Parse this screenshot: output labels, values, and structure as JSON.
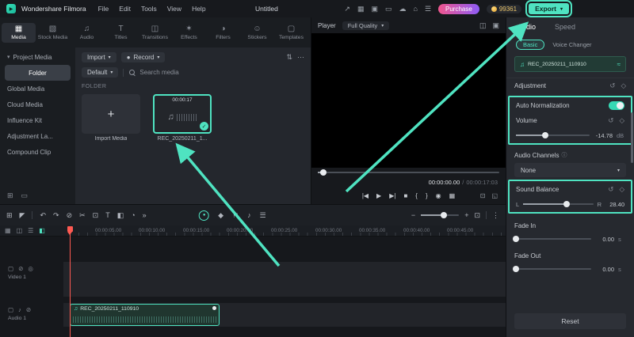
{
  "colors": {
    "accent": "#4fe3c1",
    "playhead": "#ff5a52"
  },
  "menubar": {
    "app_name": "Wondershare Filmora",
    "menus": [
      "File",
      "Edit",
      "Tools",
      "View",
      "Help"
    ],
    "project_title": "Untitled",
    "purchase_label": "Purchase",
    "coin_count": "99361",
    "export_label": "Export"
  },
  "media_panel": {
    "tabs": [
      "Media",
      "Stock Media",
      "Audio",
      "Titles",
      "Transitions",
      "Effects",
      "Filters",
      "Stickers",
      "Templates"
    ],
    "sidebar": [
      "Project Media",
      "Folder",
      "Global Media",
      "Cloud Media",
      "Influence Kit",
      "Adjustment La...",
      "Compound Clip"
    ],
    "toolbar": {
      "import_label": "Import",
      "record_label": "Record",
      "default_label": "Default",
      "search_placeholder": "Search media"
    },
    "folder_label": "FOLDER",
    "import_tile_label": "Import Media",
    "clip_name": "REC_20250211_1...",
    "clip_duration": "00:00:17"
  },
  "player": {
    "title": "Player",
    "quality": "Full Quality",
    "current_time": "00:00:00.00",
    "separator": "/",
    "total_time": "00:00:17:03"
  },
  "props": {
    "tab_audio": "Audio",
    "tab_speed": "Speed",
    "subtab_basic": "Basic",
    "subtab_voice": "Voice Changer",
    "clip_name": "REC_20250211_110910",
    "adjustment": "Adjustment",
    "auto_normalization": "Auto Normalization",
    "volume": "Volume",
    "volume_value": "-14.78",
    "volume_unit": "dB",
    "audio_channels": "Audio Channels",
    "channels_value": "None",
    "sound_balance": "Sound Balance",
    "balance_left": "L",
    "balance_right": "R",
    "balance_value": "28.40",
    "fade_in": "Fade In",
    "fade_in_value": "0.00",
    "fade_out": "Fade Out",
    "fade_out_value": "0.00",
    "unit_s": "s",
    "reset_label": "Reset"
  },
  "timeline": {
    "ruler": [
      "00:00:05.00",
      "00:00:10.00",
      "00:00:15.00",
      "00:00:20.00",
      "00:00:25.00",
      "00:00:30.00",
      "00:00:35.00",
      "00:00:40.00",
      "00:00:45.00"
    ],
    "video_track": "Video 1",
    "audio_track": "Audio 1",
    "clip_name": "REC_20250211_110910"
  },
  "icons": {
    "logo": "▶",
    "caret": "▾",
    "share": "↗",
    "layout": "▦",
    "screen": "▣",
    "device": "▭",
    "cloud": "☁",
    "home": "⌂",
    "menu": "☰",
    "record_dot": "●",
    "filter": "⇅",
    "more_h": "⋯",
    "more_v": "⋮",
    "plus": "+",
    "music": "♫",
    "check": "✓",
    "compare": "◫",
    "panel": "▣",
    "prev": "|◀",
    "play": "▶",
    "next": "▶|",
    "stop": "■",
    "mark_in": "{",
    "mark_out": "}",
    "snapshot": "◉",
    "grid": "▦",
    "crop": "⊡",
    "expand": "◱",
    "snap": "⊞",
    "pointer": "◤",
    "undo": "↶",
    "redo": "↷",
    "trash": "⊘",
    "split": "✂",
    "text": "T",
    "mask": "◧",
    "speed": "◔",
    "chevrons": "»",
    "keyframe": "◆",
    "marker": "⚑",
    "mic": "♪",
    "mixer": "☰",
    "zoom_out": "−",
    "zoom_in": "+",
    "fit": "⊡",
    "reset": "↺",
    "diamond": "◇",
    "info": "ⓘ",
    "wave": "≈",
    "track_box": "▢",
    "track_mute": "⊘",
    "track_eye": "◎",
    "track_note": "♪",
    "folder_add": "⊞",
    "folder": "▭",
    "chev": "▾",
    "t_media": "▦",
    "t_stock": "▧",
    "t_audio": "♫",
    "t_titles": "T",
    "t_transitions": "◫",
    "t_effects": "✶",
    "t_filters": "◑",
    "t_stickers": "☺",
    "t_templates": "▢"
  }
}
